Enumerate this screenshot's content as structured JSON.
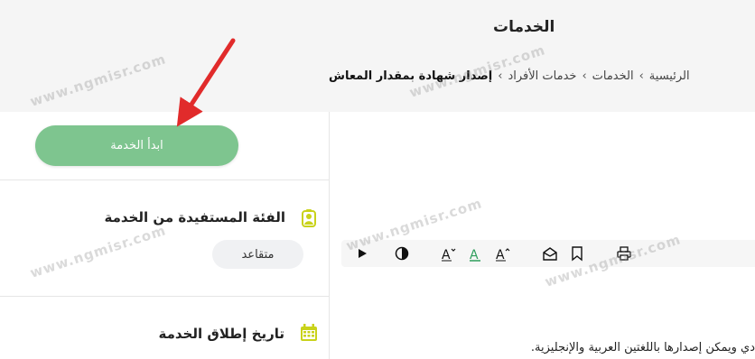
{
  "header": {
    "title": "الخدمات",
    "breadcrumb": [
      "الرئيسية",
      "الخدمات",
      "خدمات الأفراد"
    ],
    "breadcrumb_current": "إصدار شهادة  بمقدار المعاش"
  },
  "start_button": {
    "label": "ابدأ الخدمة",
    "color": "#7ec58f"
  },
  "sections": {
    "beneficiary_title": "الفئة المستفيدة من الخدمة",
    "beneficiary_badge": "متقاعد",
    "launch_date_title": "تاريخ إطلاق الخدمة"
  },
  "body_text": "دي ويمكن إصدارها باللغتين العربية والإنجليزية.",
  "watermark": "www.ngmisr.com",
  "colors": {
    "accent_yellow": "#c9d21a",
    "arrow_red": "#e12b2b",
    "green_a": "#2e9e5b"
  }
}
